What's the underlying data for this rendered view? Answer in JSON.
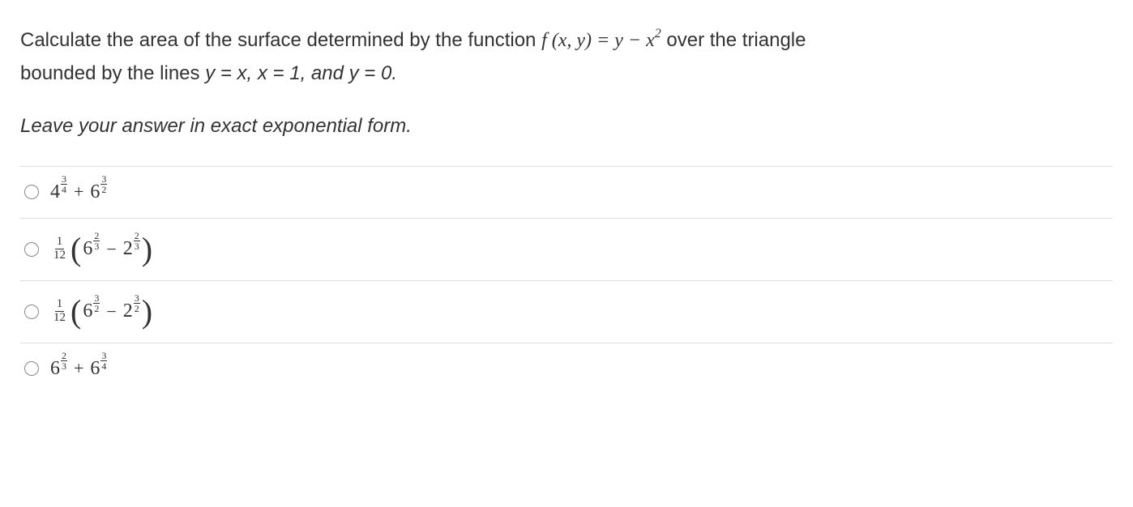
{
  "question": {
    "line1_part1": "Calculate the area of the surface determined by the function ",
    "fn_prefix": "f",
    "fn_args": " (x, y) = y − x",
    "fn_exp": "2",
    "line1_part2": " over the triangle",
    "line2_part1": "bounded by the lines ",
    "bounds_text": "y = x, x = 1, and y = 0."
  },
  "instruction": "Leave your answer in exact exponential form.",
  "options": {
    "a": {
      "term1_base": "4",
      "term1_exp_num": "3",
      "term1_exp_den": "4",
      "op": "+",
      "term2_base": "6",
      "term2_exp_num": "3",
      "term2_exp_den": "2"
    },
    "b": {
      "coef_num": "1",
      "coef_den": "12",
      "term1_base": "6",
      "term1_exp_num": "2",
      "term1_exp_den": "3",
      "op": "−",
      "term2_base": "2",
      "term2_exp_num": "2",
      "term2_exp_den": "3"
    },
    "c": {
      "coef_num": "1",
      "coef_den": "12",
      "term1_base": "6",
      "term1_exp_num": "3",
      "term1_exp_den": "2",
      "op": "−",
      "term2_base": "2",
      "term2_exp_num": "3",
      "term2_exp_den": "2"
    },
    "d": {
      "term1_base": "6",
      "term1_exp_num": "2",
      "term1_exp_den": "3",
      "op": "+",
      "term2_base": "6",
      "term2_exp_num": "3",
      "term2_exp_den": "4"
    }
  }
}
